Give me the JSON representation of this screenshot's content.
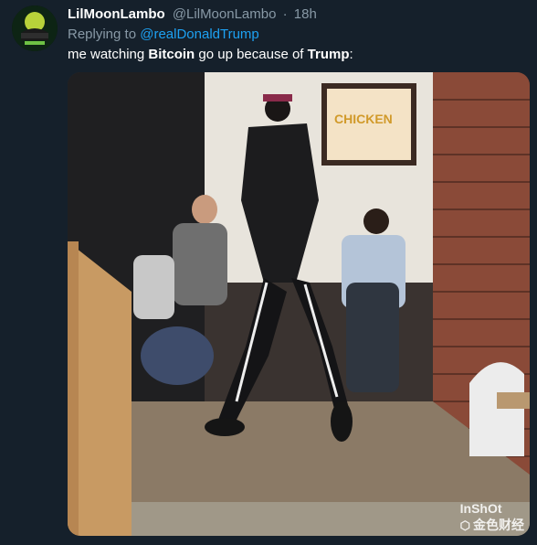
{
  "tweet": {
    "display_name": "LilMoonLambo",
    "handle": "@LilMoonLambo",
    "separator": "·",
    "time": "18h",
    "replying_prefix": "Replying to",
    "reply_to": "@realDonaldTrump",
    "text_parts": {
      "p1": "me watching ",
      "bold1": "Bitcoin",
      "p2": " go up because of ",
      "bold2": "Trump",
      "p3": ":"
    },
    "media_sign_text": "CHICKEN"
  },
  "watermark": {
    "brand": "InShOt",
    "logo": "⬡",
    "cn": "金色财经"
  },
  "colors": {
    "background": "#15202b",
    "secondary": "#8899a6",
    "link": "#1da1f2"
  }
}
